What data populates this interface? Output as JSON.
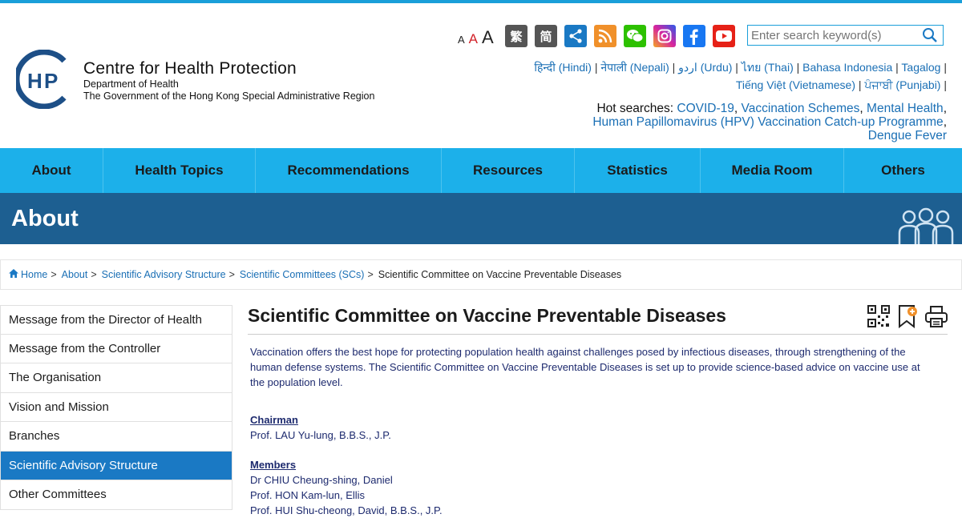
{
  "header": {
    "org_name": "Centre for Health Protection",
    "dept": "Department of Health",
    "gov": "The Government of the Hong Kong Special Administrative Region",
    "logo_text": "CHP",
    "font_sizes": [
      "A",
      "A",
      "A"
    ],
    "lang_trad": "繁",
    "lang_simp": "简",
    "search_placeholder": "Enter search keyword(s)",
    "social_icons": [
      "share-icon",
      "rss-icon",
      "wechat-icon",
      "instagram-icon",
      "facebook-icon",
      "youtube-icon"
    ],
    "accent_color": "#1a9fd9"
  },
  "languages": {
    "line1": [
      "हिन्दी (Hindi)",
      "नेपाली (Nepali)",
      "اردو (Urdu)",
      "ไทย (Thai)",
      "Bahasa Indonesia",
      "Tagalog"
    ],
    "line2": [
      "Tiếng Việt (Vietnamese)",
      "ਪੰਜਾਬੀ (Punjabi)"
    ],
    "sep": "|"
  },
  "hot_searches": {
    "label": "Hot searches:",
    "items": [
      "COVID-19",
      "Vaccination Schemes",
      "Mental Health",
      "Human Papillomavirus (HPV) Vaccination Catch-up Programme",
      "Dengue Fever"
    ]
  },
  "nav": {
    "items": [
      "About",
      "Health Topics",
      "Recommendations",
      "Resources",
      "Statistics",
      "Media Room",
      "Others"
    ],
    "color": "#1cb0ea"
  },
  "banner": {
    "title": "About",
    "color": "#1d5f91"
  },
  "breadcrumb": {
    "items": [
      "Home",
      "About",
      "Scientific Advisory Structure",
      "Scientific Committees (SCs)"
    ],
    "current": "Scientific Committee on Vaccine Preventable Diseases",
    "sep": ">"
  },
  "sidebar": {
    "items": [
      "Message from the Director of Health",
      "Message from the Controller",
      "The Organisation",
      "Vision and Mission",
      "Branches",
      "Scientific Advisory Structure",
      "Other Committees"
    ],
    "active_index": 5
  },
  "content": {
    "title": "Scientific Committee on Vaccine Preventable Diseases",
    "intro": "Vaccination offers the best hope for protecting population health against challenges posed by infectious diseases, through strengthening of the human defense systems. The Scientific Committee on Vaccine Preventable Diseases is set up to provide science-based advice on vaccine use at the population level.",
    "chairman_heading": "Chairman",
    "chairman": "Prof. LAU Yu-lung, B.B.S., J.P.",
    "members_heading": "Members",
    "members": [
      "Dr CHIU Cheung-shing, Daniel",
      "Prof. HON Kam-lun, Ellis",
      "Prof. HUI Shu-cheong, David, B.B.S., J.P."
    ]
  }
}
